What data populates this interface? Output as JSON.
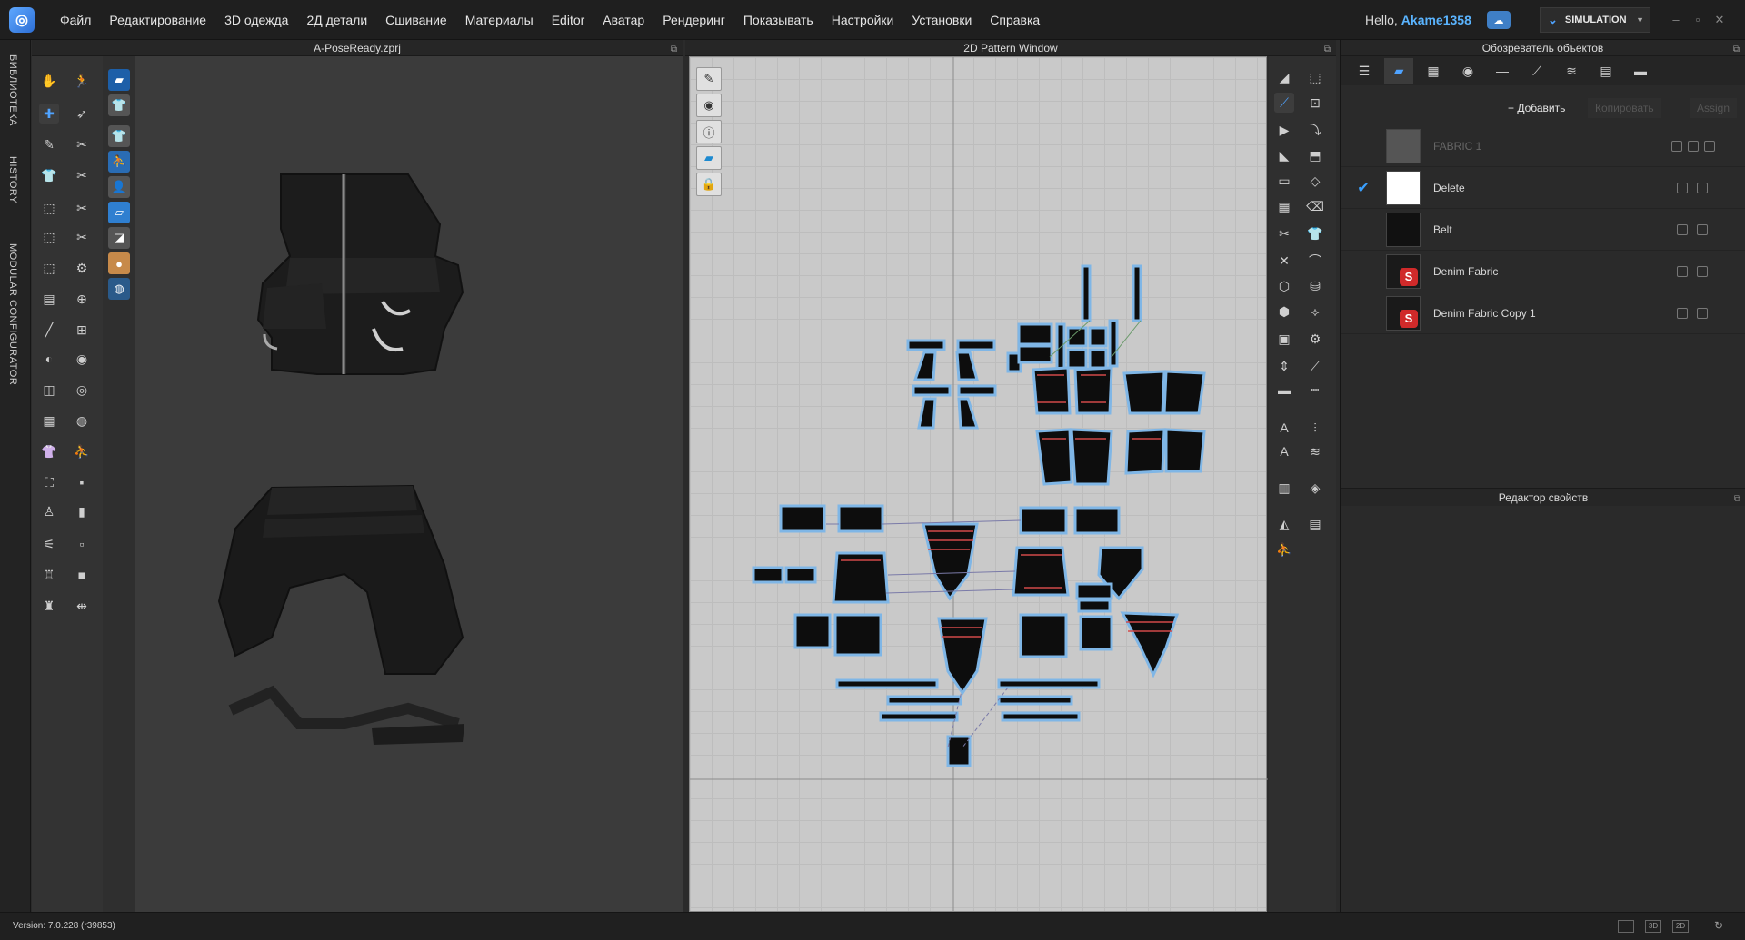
{
  "app": {
    "logo_icon": "clo-logo-icon"
  },
  "menu": [
    "Файл",
    "Редактирование",
    "3D одежда",
    "2Д детали",
    "Сшивание",
    "Материалы",
    "Editor",
    "Аватар",
    "Рендеринг",
    "Показывать",
    "Настройки",
    "Установки",
    "Справка"
  ],
  "user": {
    "greeting": "Hello,",
    "name": "Akame1358"
  },
  "mode": {
    "label": "SIMULATION"
  },
  "side_tabs": [
    "БИБЛИОТЕКА",
    "HISTORY",
    "MODULAR CONFIGURATOR"
  ],
  "win3d": {
    "title": "A-PoseReady.zprj"
  },
  "win2d": {
    "title": "2D Pattern Window"
  },
  "object_browser": {
    "title": "Обозреватель объектов",
    "add_label": "+ Добавить",
    "copy_label": "Копировать",
    "assign_label": "Assign",
    "fabrics": [
      {
        "name": "FABRIC 1",
        "swatch": "#555555",
        "dim": true,
        "checked": false
      },
      {
        "name": "Delete",
        "swatch": "#ffffff",
        "dim": false,
        "checked": true
      },
      {
        "name": "Belt",
        "swatch": "#111111",
        "dim": false,
        "checked": false
      },
      {
        "name": "Denim Fabric",
        "swatch": "#1a1a1a",
        "dim": false,
        "checked": false,
        "badge": "S"
      },
      {
        "name": "Denim Fabric Copy 1",
        "swatch": "#1a1a1a",
        "dim": false,
        "checked": false,
        "badge": "S"
      }
    ]
  },
  "properties": {
    "title": "Редактор свойств"
  },
  "status": {
    "version": "Version: 7.0.228 (r39853)"
  },
  "colors": {
    "accent": "#3aa0ff",
    "pattern_outline": "#7fb6e6",
    "pattern_fill": "#0d0d0d",
    "stitch": "#d24a4a"
  }
}
